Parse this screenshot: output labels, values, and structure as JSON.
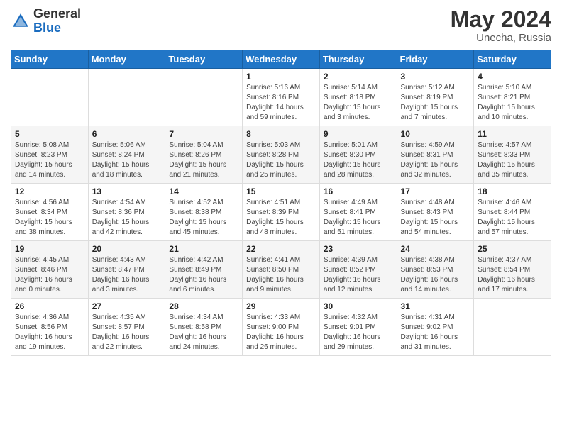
{
  "header": {
    "logo_general": "General",
    "logo_blue": "Blue",
    "month": "May 2024",
    "location": "Unecha, Russia"
  },
  "days_of_week": [
    "Sunday",
    "Monday",
    "Tuesday",
    "Wednesday",
    "Thursday",
    "Friday",
    "Saturday"
  ],
  "weeks": [
    [
      {
        "day": "",
        "info": ""
      },
      {
        "day": "",
        "info": ""
      },
      {
        "day": "",
        "info": ""
      },
      {
        "day": "1",
        "info": "Sunrise: 5:16 AM\nSunset: 8:16 PM\nDaylight: 14 hours\nand 59 minutes."
      },
      {
        "day": "2",
        "info": "Sunrise: 5:14 AM\nSunset: 8:18 PM\nDaylight: 15 hours\nand 3 minutes."
      },
      {
        "day": "3",
        "info": "Sunrise: 5:12 AM\nSunset: 8:19 PM\nDaylight: 15 hours\nand 7 minutes."
      },
      {
        "day": "4",
        "info": "Sunrise: 5:10 AM\nSunset: 8:21 PM\nDaylight: 15 hours\nand 10 minutes."
      }
    ],
    [
      {
        "day": "5",
        "info": "Sunrise: 5:08 AM\nSunset: 8:23 PM\nDaylight: 15 hours\nand 14 minutes."
      },
      {
        "day": "6",
        "info": "Sunrise: 5:06 AM\nSunset: 8:24 PM\nDaylight: 15 hours\nand 18 minutes."
      },
      {
        "day": "7",
        "info": "Sunrise: 5:04 AM\nSunset: 8:26 PM\nDaylight: 15 hours\nand 21 minutes."
      },
      {
        "day": "8",
        "info": "Sunrise: 5:03 AM\nSunset: 8:28 PM\nDaylight: 15 hours\nand 25 minutes."
      },
      {
        "day": "9",
        "info": "Sunrise: 5:01 AM\nSunset: 8:30 PM\nDaylight: 15 hours\nand 28 minutes."
      },
      {
        "day": "10",
        "info": "Sunrise: 4:59 AM\nSunset: 8:31 PM\nDaylight: 15 hours\nand 32 minutes."
      },
      {
        "day": "11",
        "info": "Sunrise: 4:57 AM\nSunset: 8:33 PM\nDaylight: 15 hours\nand 35 minutes."
      }
    ],
    [
      {
        "day": "12",
        "info": "Sunrise: 4:56 AM\nSunset: 8:34 PM\nDaylight: 15 hours\nand 38 minutes."
      },
      {
        "day": "13",
        "info": "Sunrise: 4:54 AM\nSunset: 8:36 PM\nDaylight: 15 hours\nand 42 minutes."
      },
      {
        "day": "14",
        "info": "Sunrise: 4:52 AM\nSunset: 8:38 PM\nDaylight: 15 hours\nand 45 minutes."
      },
      {
        "day": "15",
        "info": "Sunrise: 4:51 AM\nSunset: 8:39 PM\nDaylight: 15 hours\nand 48 minutes."
      },
      {
        "day": "16",
        "info": "Sunrise: 4:49 AM\nSunset: 8:41 PM\nDaylight: 15 hours\nand 51 minutes."
      },
      {
        "day": "17",
        "info": "Sunrise: 4:48 AM\nSunset: 8:43 PM\nDaylight: 15 hours\nand 54 minutes."
      },
      {
        "day": "18",
        "info": "Sunrise: 4:46 AM\nSunset: 8:44 PM\nDaylight: 15 hours\nand 57 minutes."
      }
    ],
    [
      {
        "day": "19",
        "info": "Sunrise: 4:45 AM\nSunset: 8:46 PM\nDaylight: 16 hours\nand 0 minutes."
      },
      {
        "day": "20",
        "info": "Sunrise: 4:43 AM\nSunset: 8:47 PM\nDaylight: 16 hours\nand 3 minutes."
      },
      {
        "day": "21",
        "info": "Sunrise: 4:42 AM\nSunset: 8:49 PM\nDaylight: 16 hours\nand 6 minutes."
      },
      {
        "day": "22",
        "info": "Sunrise: 4:41 AM\nSunset: 8:50 PM\nDaylight: 16 hours\nand 9 minutes."
      },
      {
        "day": "23",
        "info": "Sunrise: 4:39 AM\nSunset: 8:52 PM\nDaylight: 16 hours\nand 12 minutes."
      },
      {
        "day": "24",
        "info": "Sunrise: 4:38 AM\nSunset: 8:53 PM\nDaylight: 16 hours\nand 14 minutes."
      },
      {
        "day": "25",
        "info": "Sunrise: 4:37 AM\nSunset: 8:54 PM\nDaylight: 16 hours\nand 17 minutes."
      }
    ],
    [
      {
        "day": "26",
        "info": "Sunrise: 4:36 AM\nSunset: 8:56 PM\nDaylight: 16 hours\nand 19 minutes."
      },
      {
        "day": "27",
        "info": "Sunrise: 4:35 AM\nSunset: 8:57 PM\nDaylight: 16 hours\nand 22 minutes."
      },
      {
        "day": "28",
        "info": "Sunrise: 4:34 AM\nSunset: 8:58 PM\nDaylight: 16 hours\nand 24 minutes."
      },
      {
        "day": "29",
        "info": "Sunrise: 4:33 AM\nSunset: 9:00 PM\nDaylight: 16 hours\nand 26 minutes."
      },
      {
        "day": "30",
        "info": "Sunrise: 4:32 AM\nSunset: 9:01 PM\nDaylight: 16 hours\nand 29 minutes."
      },
      {
        "day": "31",
        "info": "Sunrise: 4:31 AM\nSunset: 9:02 PM\nDaylight: 16 hours\nand 31 minutes."
      },
      {
        "day": "",
        "info": ""
      }
    ]
  ]
}
